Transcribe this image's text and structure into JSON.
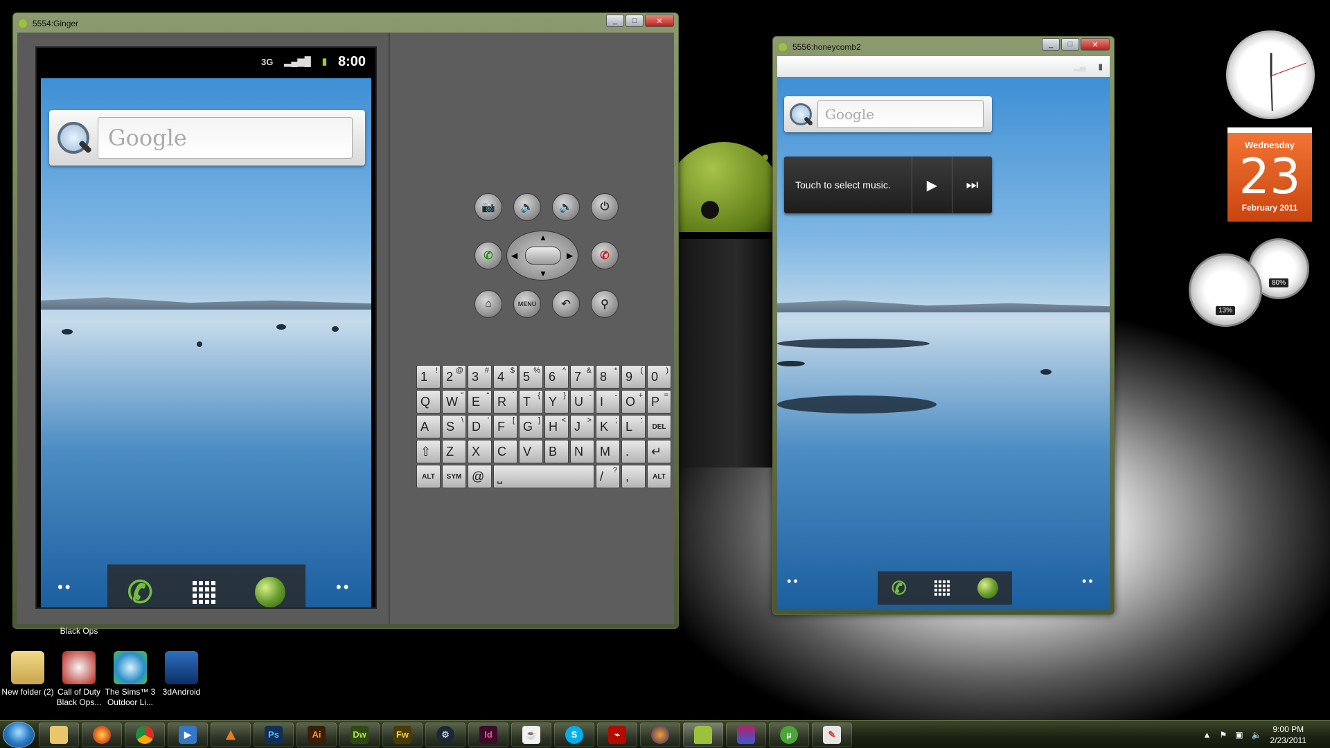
{
  "ginger": {
    "title": "5554:Ginger",
    "time": "8:00",
    "network": "3G",
    "search_text": "Google",
    "menu_label": "MENU",
    "keyboard_rows": [
      [
        [
          "1",
          "!"
        ],
        [
          "2",
          "@"
        ],
        [
          "3",
          "#"
        ],
        [
          "4",
          "$"
        ],
        [
          "5",
          "%"
        ],
        [
          "6",
          "^"
        ],
        [
          "7",
          "&"
        ],
        [
          "8",
          "*"
        ],
        [
          "9",
          "("
        ],
        [
          "0",
          ")"
        ]
      ],
      [
        [
          "Q",
          ""
        ],
        [
          "W",
          "\""
        ],
        [
          "E",
          "“"
        ],
        [
          "R",
          "`"
        ],
        [
          "T",
          "{"
        ],
        [
          "Y",
          "}"
        ],
        [
          "U",
          "-"
        ],
        [
          "I",
          "-"
        ],
        [
          "O",
          "+"
        ],
        [
          "P",
          "="
        ]
      ],
      [
        [
          "A",
          ""
        ],
        [
          "S",
          "\\"
        ],
        [
          "D",
          "'"
        ],
        [
          "F",
          "["
        ],
        [
          "G",
          "]"
        ],
        [
          "H",
          "<"
        ],
        [
          "J",
          ">"
        ],
        [
          "K",
          ";"
        ],
        [
          "L",
          ":"
        ],
        [
          "DEL",
          ""
        ]
      ],
      [
        [
          "⇧",
          ""
        ],
        [
          "Z",
          ""
        ],
        [
          "X",
          ""
        ],
        [
          "C",
          ""
        ],
        [
          "V",
          ""
        ],
        [
          "B",
          ""
        ],
        [
          "N",
          ""
        ],
        [
          "M",
          ""
        ],
        [
          ".",
          ""
        ],
        [
          "↵",
          ""
        ]
      ]
    ],
    "keyboard_bottom": {
      "alt": "ALT",
      "sym": "SYM",
      "at": "@",
      "slash": "/",
      "question": "?",
      "comma": ","
    }
  },
  "honeycomb": {
    "title": "5556:honeycomb2",
    "search_text": "Google",
    "music_text": "Touch to select music."
  },
  "gadgets": {
    "calendar_day": "Wednesday",
    "calendar_date": "23",
    "calendar_month": "February 2011",
    "cpu_percent": "13%",
    "mem_percent": "80%"
  },
  "desktop_icons": [
    {
      "label": "New folder (2)"
    },
    {
      "label": "Call of Duty Black Ops..."
    },
    {
      "label": "The Sims™ 3 Outdoor Li..."
    },
    {
      "label": "3dAndroid"
    }
  ],
  "desktop_caption": "Black Ops",
  "taskbar": {
    "apps": [
      "Ps",
      "Ai",
      "Dw",
      "Fw",
      "Id"
    ],
    "time": "9:00 PM",
    "date": "2/23/2011"
  },
  "colors": {
    "taskbar": "#1b2212",
    "accent_green": "#73c03a",
    "calendar": "#e85f22"
  }
}
